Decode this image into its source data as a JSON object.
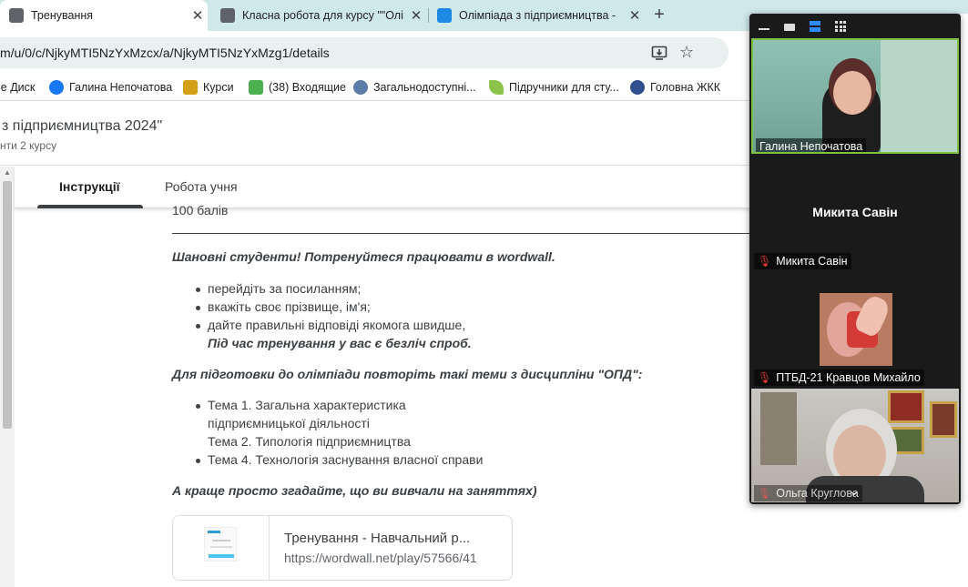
{
  "browser": {
    "tabs": [
      {
        "title": "Тренування",
        "active": true
      },
      {
        "title": "Класна робота для курсу \"\"Олі",
        "active": false
      },
      {
        "title": "Олімпіада з підприємництва -",
        "active": false
      }
    ],
    "tab_close": "✕",
    "new_tab": "+",
    "url": "m/u/0/c/NjkyMTI5NzYxMzcx/a/NjkyMTI5NzYxMzg1/details",
    "star": "☆"
  },
  "bookmarks": [
    {
      "label": "le Диск",
      "icon": "drive-icon",
      "color": "#f4b400"
    },
    {
      "label": "Галина Непочатова",
      "icon": "facebook-icon",
      "color": "#1877f2"
    },
    {
      "label": "Курси",
      "icon": "courses-icon",
      "color": "#d4a017"
    },
    {
      "label": "(38) Входящие",
      "icon": "mail-icon",
      "color": "#4caf50"
    },
    {
      "label": "Загальнодоступні...",
      "icon": "people-icon",
      "color": "#5c7ea6"
    },
    {
      "label": "Підручники для сту...",
      "icon": "leaf-icon",
      "color": "#8bc34a"
    },
    {
      "label": "Головна ЖКК",
      "icon": "globe-icon",
      "color": "#2f4f8f"
    }
  ],
  "page": {
    "title": "з підприємництва 2024\"",
    "subtitle": "нти 2 курсу"
  },
  "tabs": {
    "instructions": "Інструкції",
    "student_work": "Робота учня"
  },
  "content": {
    "points": "100 балів",
    "greeting": "Шановні студенти! Потренуйтеся працювати в wordwall.",
    "steps": [
      "перейдіть за посиланням;",
      "вкажіть своє прізвище, ім'я;",
      "дайте правильні відповіді якомога швидше,"
    ],
    "tries_note": "Під час тренування у вас є безліч спроб.",
    "prep_heading": "Для підготовки до олімпіади повторіть такі теми з дисципліни \"ОПД\":",
    "topics_line1": "Тема 1.  Загальна характеристика",
    "topics_line2": "підприємницької діяльності",
    "topics_line3": "Тема 2. Типологія підприємництва",
    "topics_line4": "Тема 4. Технологія заснування власної справи",
    "closing": "А краще просто згадайте, що ви вивчали на заняттях)"
  },
  "link_card": {
    "title": "Тренування - Навчальний р...",
    "url": "https://wordwall.net/play/57566/41"
  },
  "zoom": {
    "participants": [
      {
        "name": "Галина Непочатова",
        "muted": false
      },
      {
        "name": "Микита Савін",
        "muted": true,
        "center_name": "Микита Савін"
      },
      {
        "name": "ПТБД-21 Кравцов Михайло",
        "muted": true
      },
      {
        "name": "Ольга Круглова",
        "muted": true
      }
    ]
  }
}
